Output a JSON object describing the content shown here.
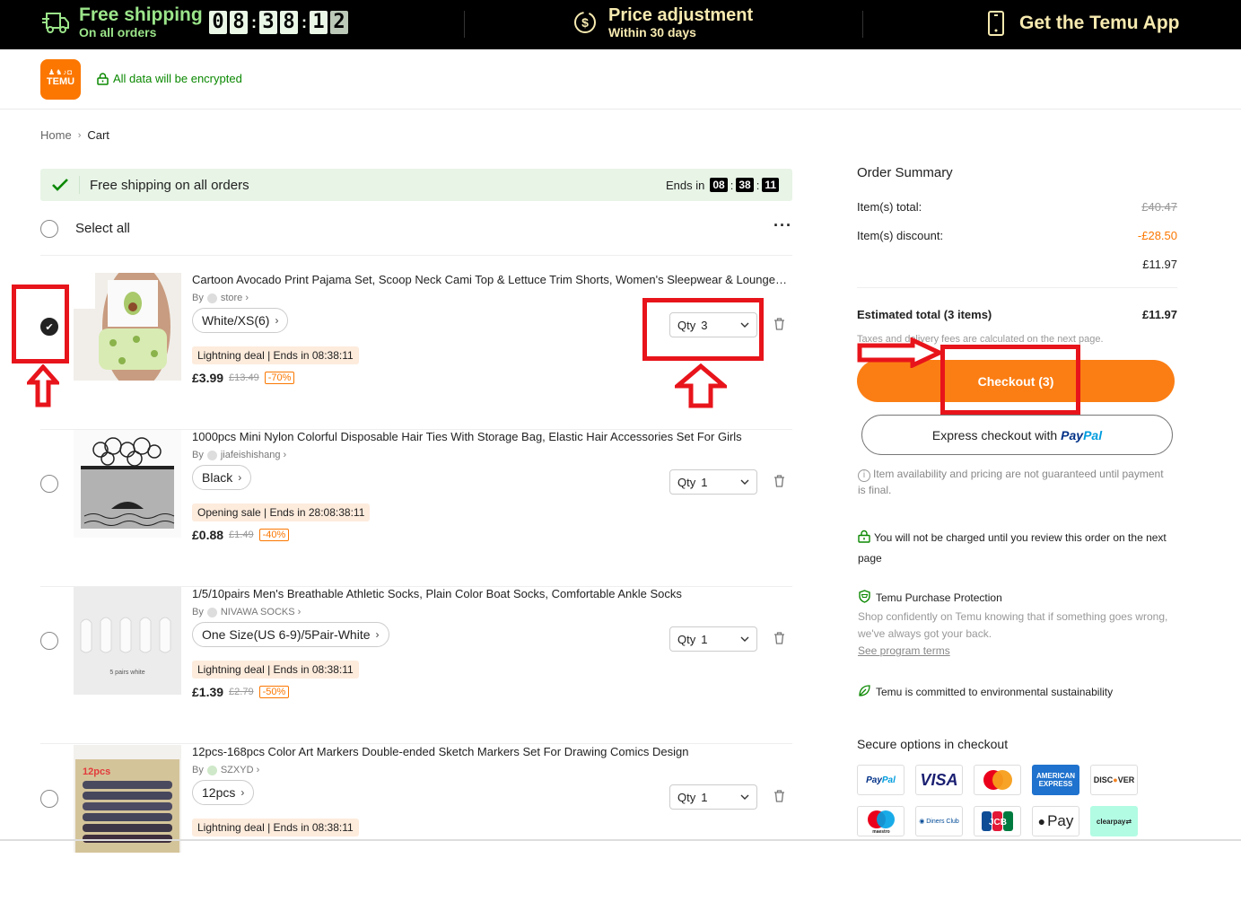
{
  "topbar": {
    "free_shipping_title": "Free shipping",
    "free_shipping_sub": "On all orders",
    "countdown_digits": [
      "0",
      "8",
      "3",
      "8",
      "1",
      "2"
    ],
    "price_adjust_title": "Price adjustment",
    "price_adjust_sub": "Within 30 days",
    "get_app": "Get the Temu App",
    "colors": {
      "green": "#9be58a",
      "gold": "#f7eab0"
    }
  },
  "header": {
    "logo_text": "TEMU",
    "encrypted": "All data will be encrypted"
  },
  "breadcrumb": {
    "home": "Home",
    "current": "Cart"
  },
  "banner": {
    "text": "Free shipping on all orders",
    "ends_label": "Ends in",
    "hh": "08",
    "mm": "38",
    "ss": "11"
  },
  "select_all": {
    "label": "Select all",
    "more": "···"
  },
  "items": [
    {
      "title": "Cartoon Avocado Print Pajama Set, Scoop Neck Cami Top & Lettuce Trim Shorts, Women's Sleepwear & Loungewe...",
      "by": "By",
      "store": "store",
      "variant": "White/XS(6)",
      "deal": "Lightning deal | Ends in  08:38:11",
      "price": "£3.99",
      "was": "£13.49",
      "off": "-70%",
      "qty_label": "Qty",
      "qty": "3",
      "checked": true
    },
    {
      "title": "1000pcs Mini Nylon Colorful Disposable Hair Ties With Storage Bag, Elastic Hair Accessories Set For Girls",
      "by": "By",
      "store": "jiafeishishang",
      "variant": "Black",
      "deal": "Opening sale | Ends in  28:08:38:11",
      "price": "£0.88",
      "was": "£1.49",
      "off": "-40%",
      "qty_label": "Qty",
      "qty": "1",
      "checked": false
    },
    {
      "title": "1/5/10pairs Men's Breathable Athletic Socks, Plain Color Boat Socks, Comfortable Ankle Socks",
      "by": "By",
      "store": "NIVAWA SOCKS",
      "variant": "One Size(US 6-9)/5Pair-White",
      "deal": "Lightning deal | Ends in  08:38:11",
      "price": "£1.39",
      "was": "£2.79",
      "off": "-50%",
      "qty_label": "Qty",
      "qty": "1",
      "thumb_caption": "5 pairs  white",
      "checked": false
    },
    {
      "title": "12pcs-168pcs Color Art Markers Double-ended Sketch Markers Set For Drawing Comics Design",
      "by": "By",
      "store": "SZXYD",
      "variant": "12pcs",
      "deal": "Lightning deal | Ends in  08:38:11",
      "qty_label": "Qty",
      "qty": "1",
      "thumb_caption": "12pcs",
      "checked": false
    }
  ],
  "summary": {
    "title": "Order Summary",
    "items_total_label": "Item(s) total:",
    "items_total": "£40.47",
    "discount_label": "Item(s) discount:",
    "discount": "-£28.50",
    "subtotal": "£11.97",
    "estimated_label": "Estimated total (3 items)",
    "estimated": "£11.97",
    "taxes_note": "Taxes and delivery fees are calculated on the next page.",
    "checkout": "Checkout (3)",
    "express": "Express checkout with",
    "paypal_1": "Pay",
    "paypal_2": "Pal",
    "availability": "Item availability and pricing are not guaranteed until payment is final.",
    "not_charged": "You will not be charged until you review this order on the next page",
    "protection_title": "Temu Purchase Protection",
    "protection_text": "Shop confidently on Temu knowing that if something goes wrong, we've always got your back.",
    "program_terms": "See program terms",
    "sustainability": "Temu is committed to environmental sustainability",
    "secure_title": "Secure options in checkout",
    "payment_methods": [
      "PayPal",
      "VISA",
      "Mastercard",
      "American Express",
      "Discover",
      "Maestro",
      "Diners Club",
      "JCB",
      "Apple Pay",
      "clearpay"
    ],
    "accent": "#fb7e14"
  }
}
